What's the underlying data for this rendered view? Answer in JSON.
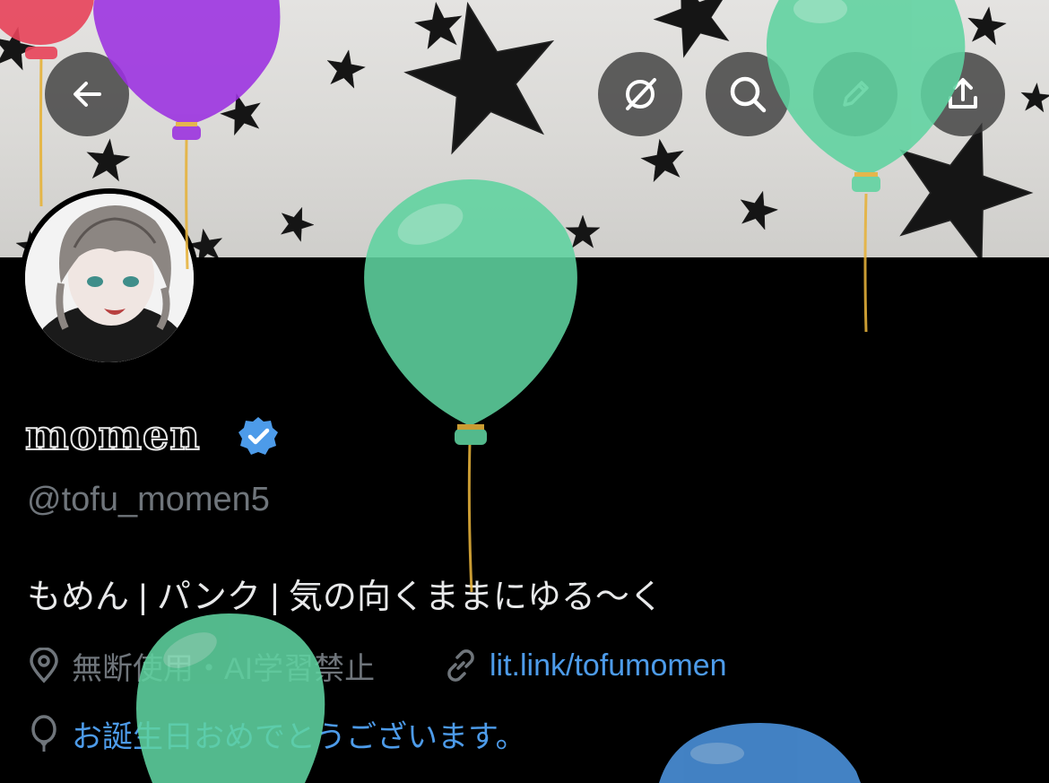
{
  "profile": {
    "display_name": "momen",
    "handle": "@tofu_momen5",
    "bio": "もめん | パンク | 気の向くままにゆる〜く",
    "location": "無断使用・AI学習禁止",
    "website": "lit.link/tofumomen",
    "birthday_message": "お誕生日おめでとうございます。",
    "verified": true
  },
  "header": {
    "buttons": [
      {
        "icon": "back-arrow-icon"
      },
      {
        "icon": "grok-icon"
      },
      {
        "icon": "search-icon"
      },
      {
        "icon": "edit-pencil-icon"
      },
      {
        "icon": "share-icon"
      }
    ]
  },
  "colors": {
    "background": "#000000",
    "link": "#4d9be9",
    "muted_text": "#6f757b",
    "verified_badge": "#4d9be9",
    "balloon_green": "#5fd3a0",
    "balloon_purple": "#9b30e0",
    "balloon_red": "#e8435a",
    "balloon_blue": "#4a90d9"
  }
}
